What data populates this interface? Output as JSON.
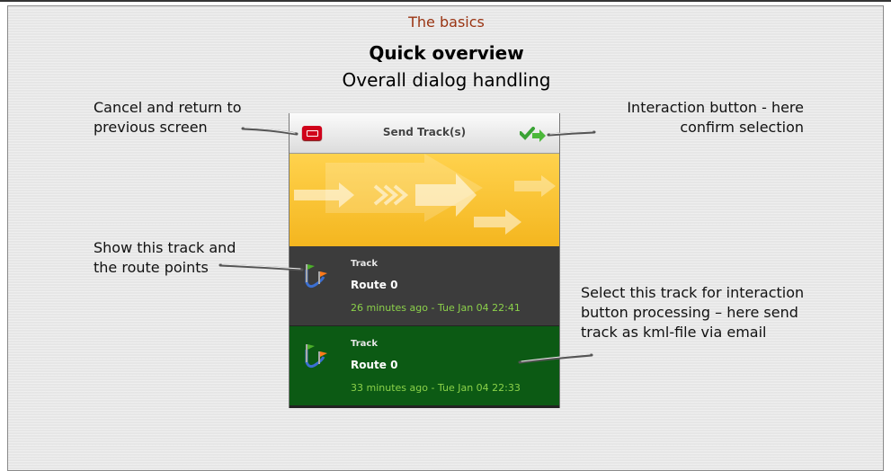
{
  "header": {
    "section": "The basics",
    "title": "Quick overview",
    "subtitle": "Overall dialog handling"
  },
  "notes": {
    "cancel": [
      "Cancel and return to",
      "previous screen"
    ],
    "interaction": [
      "Interaction button - here",
      "confirm selection"
    ],
    "show_track": [
      "Show this track and",
      "the route points"
    ],
    "select_track": [
      "Select this track for interaction",
      "button processing – here send",
      "track as kml-file via email"
    ]
  },
  "dialog": {
    "title": "Send Track(s)",
    "cancel_icon": "cancel-icon",
    "confirm_icon": "checkmark-arrow-icon",
    "items": [
      {
        "type": "Track",
        "name": "Route 0",
        "time": "26 minutes ago - Tue Jan 04 22:41",
        "selected": false
      },
      {
        "type": "Track",
        "name": "Route 0",
        "time": "33 minutes ago - Tue Jan 04 22:33",
        "selected": true
      }
    ]
  },
  "colors": {
    "section": "#9a3412",
    "selected_row": "#0c5a14",
    "unselected_row": "#3c3c3c",
    "time_text": "#8bd14a",
    "banner": "#f7c331"
  }
}
